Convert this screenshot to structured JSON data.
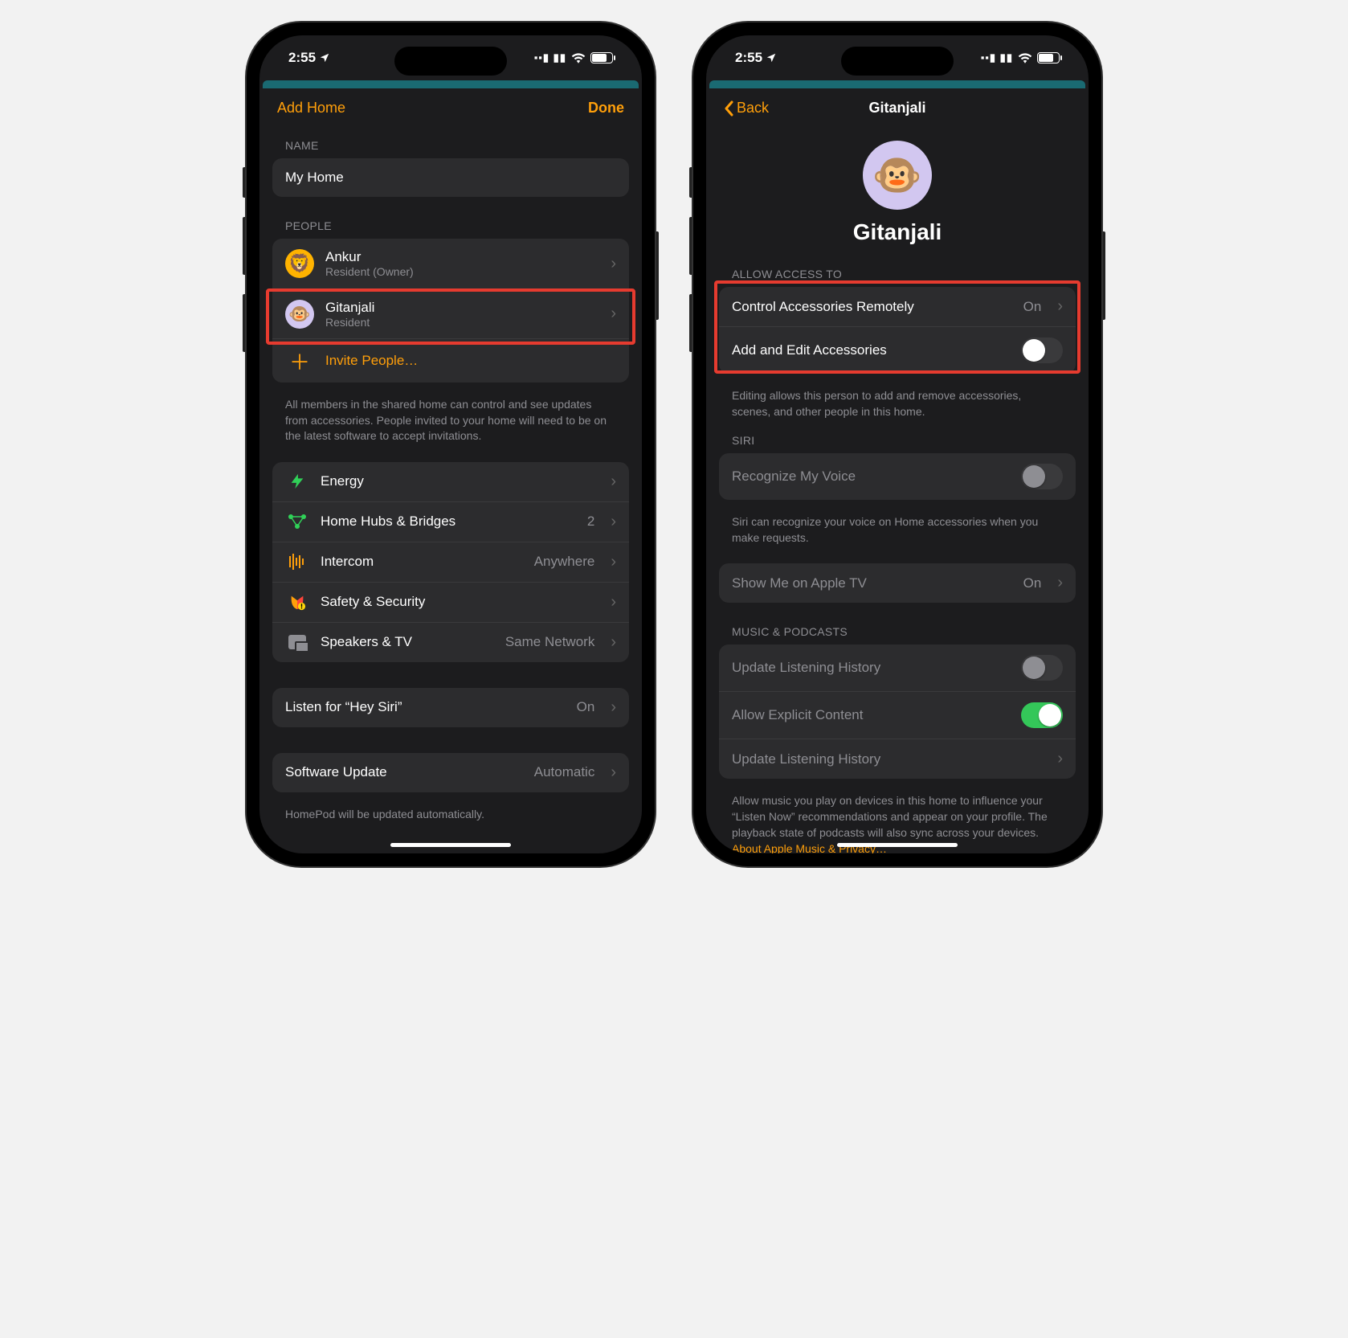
{
  "status": {
    "time": "2:55",
    "location_arrow": "➤",
    "cellular_icon": "▮▮",
    "wifi_icon": "wifi",
    "battery_icon": "battery"
  },
  "left": {
    "nav": {
      "left": "Add Home",
      "right": "Done"
    },
    "name_header": "NAME",
    "home_name": "My Home",
    "people_header": "PEOPLE",
    "people": [
      {
        "name": "Ankur",
        "role": "Resident (Owner)",
        "avatar_emoji": "🦁",
        "avatar_tone": "yellow"
      },
      {
        "name": "Gitanjali",
        "role": "Resident",
        "avatar_emoji": "🐵",
        "avatar_tone": "lilac",
        "highlighted": true
      }
    ],
    "invite_label": "Invite People…",
    "people_footer": "All members in the shared home can control and see updates from accessories. People invited to your home will need to be on the latest software to accept invitations.",
    "settings": [
      {
        "icon": "bolt",
        "label": "Energy",
        "detail": ""
      },
      {
        "icon": "hub",
        "label": "Home Hubs & Bridges",
        "detail": "2"
      },
      {
        "icon": "intercom",
        "label": "Intercom",
        "detail": "Anywhere"
      },
      {
        "icon": "shield",
        "label": "Safety & Security",
        "detail": ""
      },
      {
        "icon": "speaker",
        "label": "Speakers & TV",
        "detail": "Same Network"
      }
    ],
    "siri_row": {
      "label": "Listen for “Hey Siri”",
      "detail": "On"
    },
    "software_row": {
      "label": "Software Update",
      "detail": "Automatic"
    },
    "software_footer": "HomePod will be updated automatically."
  },
  "right": {
    "nav": {
      "back": "Back",
      "title": "Gitanjali"
    },
    "profile": {
      "avatar_emoji": "🐵",
      "name": "Gitanjali"
    },
    "access_header": "ALLOW ACCESS TO",
    "access_rows": [
      {
        "label": "Control Accessories Remotely",
        "value_text": "On",
        "type": "disclosure"
      },
      {
        "label": "Add and Edit Accessories",
        "type": "toggle",
        "on": false
      }
    ],
    "access_footer": "Editing allows this person to add and remove accessories, scenes, and other people in this home.",
    "siri_header": "SIRI",
    "siri_rows": [
      {
        "label": "Recognize My Voice",
        "type": "toggle",
        "on": false,
        "gray": true
      }
    ],
    "siri_footer": "Siri can recognize your voice on Home accessories when you make requests.",
    "appletv_row": {
      "label": "Show Me on Apple TV",
      "value_text": "On",
      "type": "disclosure"
    },
    "music_header": "MUSIC & PODCASTS",
    "music_rows": [
      {
        "label": "Update Listening History",
        "type": "toggle",
        "on": false,
        "gray": true
      },
      {
        "label": "Allow Explicit Content",
        "type": "toggle",
        "on": true
      },
      {
        "label": "Update Listening History",
        "type": "disclosure"
      }
    ],
    "music_footer": "Allow music you play on devices in this home to influence your “Listen Now” recommendations and appear on your profile. The playback state of podcasts will also sync across your devices.",
    "privacy_link": "About Apple Music & Privacy…"
  }
}
